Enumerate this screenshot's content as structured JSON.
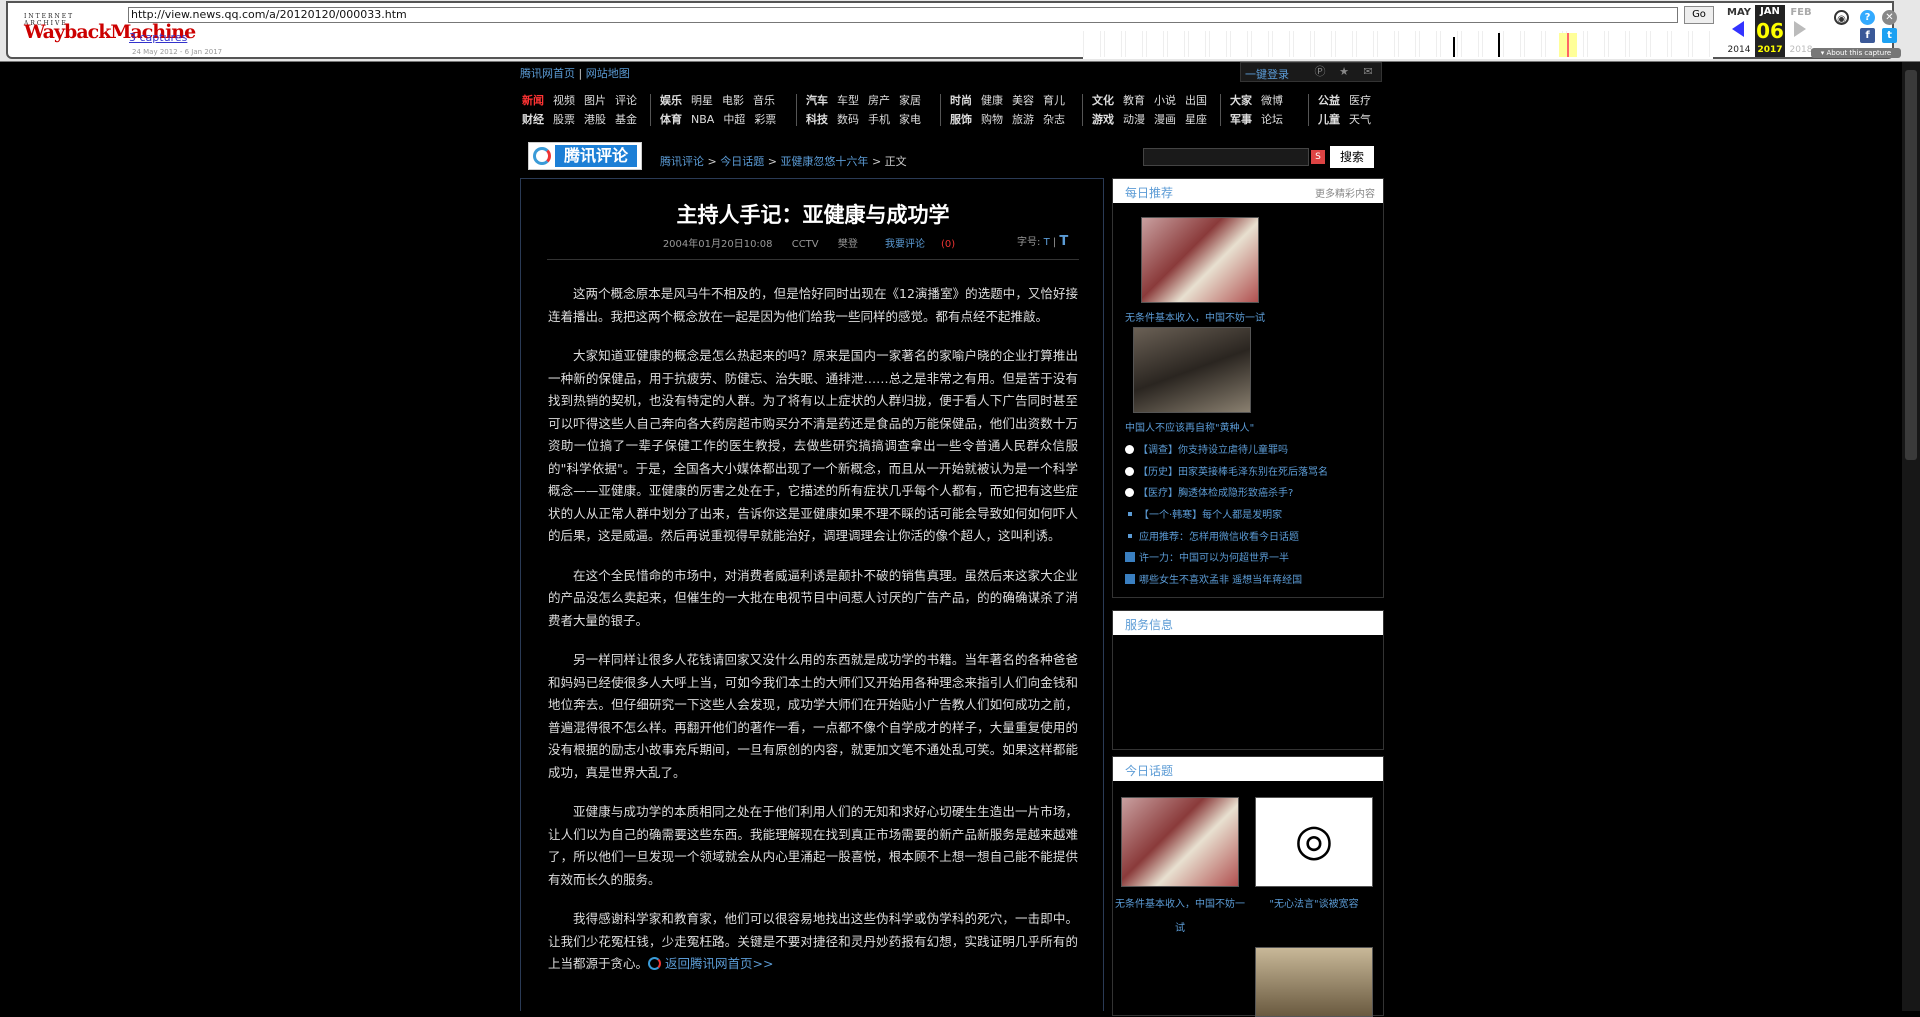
{
  "wayback": {
    "logo_top": "INTERNET ARCHIVE",
    "logo_main": "WaybackMachine",
    "url": "http://view.news.qq.com/a/20120120/000033.htm",
    "go_label": "Go",
    "captures": "3 captures",
    "date_range": "24 May 2012 - 6 Jan 2017",
    "months": {
      "prev": "MAY",
      "cur": "JAN",
      "next": "FEB"
    },
    "day": "06",
    "years": {
      "prev": "2014",
      "cur": "2017",
      "next": "2018"
    },
    "about": "About this capture",
    "icons": {
      "user": "user-icon",
      "help": "help-icon",
      "close": "close-icon",
      "facebook": "facebook-icon",
      "twitter": "twitter-icon"
    }
  },
  "top": {
    "home_link": "腾讯网首页",
    "sep": "|",
    "sitemap_link": "网站地图",
    "login": "一键登录"
  },
  "nav": {
    "groups": [
      {
        "row1": [
          "新闻",
          "视频",
          "图片",
          "评论"
        ],
        "row2": [
          "财经",
          "股票",
          "港股",
          "基金"
        ]
      },
      {
        "row1": [
          "娱乐",
          "明星",
          "电影",
          "音乐"
        ],
        "row2": [
          "体育",
          "NBA",
          "中超",
          "彩票"
        ]
      },
      {
        "row1": [
          "汽车",
          "车型",
          "房产",
          "家居"
        ],
        "row2": [
          "科技",
          "数码",
          "手机",
          "家电"
        ]
      },
      {
        "row1": [
          "时尚",
          "健康",
          "美容",
          "育儿"
        ],
        "row2": [
          "服饰",
          "购物",
          "旅游",
          "杂志"
        ]
      },
      {
        "row1": [
          "文化",
          "教育",
          "小说",
          "出国"
        ],
        "row2": [
          "游戏",
          "动漫",
          "漫画",
          "星座"
        ]
      },
      {
        "row1": [
          "大家",
          "微博"
        ],
        "row2": [
          "军事",
          "论坛"
        ]
      },
      {
        "row1": [
          "公益",
          "医疗"
        ],
        "row2": [
          "儿童",
          "天气"
        ]
      }
    ],
    "active_color": "#ff3333"
  },
  "header": {
    "logo_text": "腾讯评论",
    "crumbs": [
      "腾讯评论",
      "今日话题",
      "亚健康忽悠十六年"
    ],
    "crumb_sep": ">",
    "crumb_last": "正文",
    "search_button": "搜索"
  },
  "article": {
    "title": "主持人手记：亚健康与成功学",
    "date": "2004年01月20日10:08",
    "source": "CCTV",
    "author": "樊登",
    "comment_label": "我要评论",
    "comment_count": "(0)",
    "font_label": "字号:",
    "font_small": "T",
    "font_large": "T",
    "paragraphs": [
      "这两个概念原本是风马牛不相及的，但是恰好同时出现在《12演播室》的选题中，又恰好接连着播出。我把这两个概念放在一起是因为他们给我一些同样的感觉。都有点经不起推敲。",
      "大家知道亚健康的概念是怎么热起来的吗？原来是国内一家著名的家喻户晓的企业打算推出一种新的保健品，用于抗疲劳、防健忘、治失眠、通排泄……总之是非常之有用。但是苦于没有找到热销的契机，也没有特定的人群。为了将有以上症状的人群归拢，便于看人下广告同时甚至可以吓得这些人自己奔向各大药房超市购买分不清是药还是食品的万能保健品，他们出资数十万资助一位搞了一辈子保健工作的医生教授，去做些研究搞搞调查拿出一些令普通人民群众信服的\"科学依据\"。于是，全国各大小媒体都出现了一个新概念，而且从一开始就被认为是一个科学概念——亚健康。亚健康的厉害之处在于，它描述的所有症状几乎每个人都有，而它把有这些症状的人从正常人群中划分了出来，告诉你这是亚健康如果不理不睬的话可能会导致如何如何吓人的后果，这是威逼。然后再说重视得早就能治好，调理调理会让你活的像个超人，这叫利诱。",
      "在这个全民惜命的市场中，对消费者威逼利诱是颠扑不破的销售真理。虽然后来这家大企业的产品没怎么卖起来，但催生的一大批在电视节目中间惹人讨厌的广告产品，的的确确谋杀了消费者大量的银子。",
      "另一样同样让很多人花钱请回家又没什么用的东西就是成功学的书籍。当年著名的各种爸爸和妈妈已经使很多人大呼上当，可如今我们本土的大师们又开始用各种理念来指引人们向金钱和地位奔去。但仔细研究一下这些人会发现，成功学大师们在开始贴小广告教人们如何成功之前，普遍混得很不怎么样。再翻开他们的著作一看，一点都不像个自学成才的样子，大量重复使用的没有根据的励志小故事充斥期间，一旦有原创的内容，就更加文笔不通处乱可笑。如果这样都能成功，真是世界大乱了。",
      "亚健康与成功学的本质相同之处在于他们利用人们的无知和求好心切硬生生造出一片市场，让人们以为自己的确需要这些东西。我能理解现在找到真正市场需要的新产品新服务是越来越难了，所以他们一旦发现一个领域就会从内心里涌起一股喜悦，根本顾不上想一想自己能不能提供有效而长久的服务。"
    ],
    "last_paragraph": "我得感谢科学家和教育家，他们可以很容易地找出这些伪科学或伪学科的死穴，一击即中。让我们少花冤枉钱，少走冤枉路。关键是不要对捷径和灵丹妙药报有幻想，实践证明几乎所有的上当都源于贪心。",
    "back_link": "返回腾讯网首页>>"
  },
  "sidebar": {
    "recommend": {
      "title": "每日推荐",
      "more": "更多精彩内容",
      "captions": [
        "无条件基本收入，中国不妨一试",
        "中国人不应该再自称\"黄种人\""
      ],
      "list": [
        {
          "text": "【调查】你支持设立虐待儿童罪吗",
          "icon": "speech-bubble-icon"
        },
        {
          "text": "【历史】田家英接棒毛泽东别在死后落骂名",
          "icon": "speech-bubble-icon"
        },
        {
          "text": "【医疗】胸透体检成隐形致癌杀手?",
          "icon": "speech-bubble-icon"
        },
        {
          "text": "【一个·韩寒】每个人都是发明家",
          "icon": "dot-icon"
        },
        {
          "text": "应用推荐：怎样用微信收看今日话题",
          "icon": "dot-icon"
        },
        {
          "text": "许一力：中国可以为何超世界一半",
          "icon": "blog-icon"
        },
        {
          "text": "哪些女生不喜欢孟非 遥想当年蒋经国",
          "icon": "blog-icon"
        }
      ]
    },
    "service": {
      "title": "服务信息"
    },
    "today": {
      "title": "今日话题",
      "captions": [
        "无条件基本收入，中国不妨一试",
        "\"无心法言\"谈被宽容"
      ]
    }
  }
}
